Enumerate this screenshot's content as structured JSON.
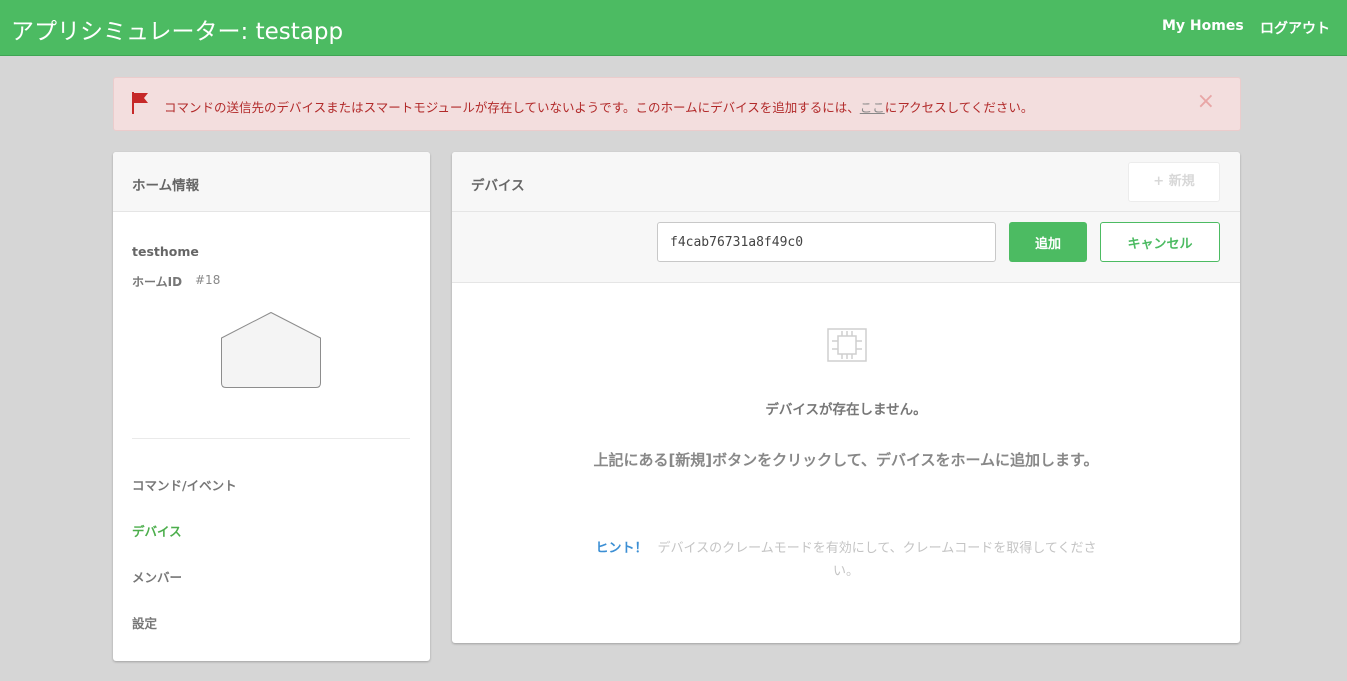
{
  "header": {
    "title": "アプリシミュレーター: testapp",
    "nav": {
      "my_homes": "My Homes",
      "logout": "ログアウト"
    }
  },
  "alert": {
    "message_before": "コマンドの送信先のデバイスまたはスマートモジュールが存在していないようです。このホームにデバイスを追加するには、",
    "link_text": "ここ",
    "message_after": "にアクセスしてください。",
    "close": "×",
    "icon": "flag-icon"
  },
  "sidebar": {
    "title": "ホーム情報",
    "home_name": "testhome",
    "home_id_label": "ホームID",
    "home_id_value": "#18",
    "image_icon": "house-icon",
    "items": [
      {
        "label": "コマンド/イベント",
        "active": false
      },
      {
        "label": "デバイス",
        "active": true
      },
      {
        "label": "メンバー",
        "active": false
      },
      {
        "label": "設定",
        "active": false
      }
    ]
  },
  "devices": {
    "title": "デバイス",
    "new_button": "+ 新規",
    "input_value": "f4cab76731a8f49c0",
    "add_button": "追加",
    "cancel_button": "キャンセル",
    "empty_icon": "chip-icon",
    "empty_title": "デバイスが存在しません。",
    "empty_desc": "上記にある[新規]ボタンをクリックして、デバイスをホームに追加します。",
    "hint_label": "ヒント！",
    "hint_text": "デバイスのクレームモードを有効にして、クレームコードを取得してください。"
  },
  "colors": {
    "brand": "#4cbb62",
    "alert_bg": "#f3dede",
    "alert_text": "#b22a2a",
    "hint_link": "#3c8fd4",
    "page_bg": "#d6d6d6"
  }
}
